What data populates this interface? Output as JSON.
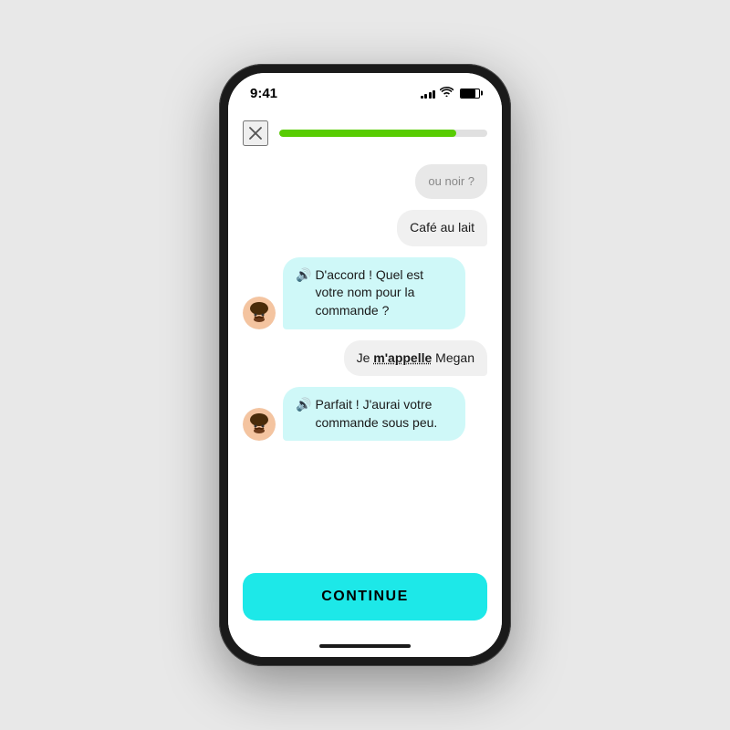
{
  "statusBar": {
    "time": "9:41",
    "signalBars": [
      3,
      5,
      7,
      9,
      11
    ],
    "batteryPercent": 80
  },
  "topBar": {
    "progressPercent": 85,
    "closeLabel": "×"
  },
  "chat": {
    "messages": [
      {
        "id": "msg1",
        "side": "right-partial",
        "text": "ou noir ?"
      },
      {
        "id": "msg2",
        "side": "right",
        "text": "Café au lait"
      },
      {
        "id": "msg3",
        "side": "left",
        "speakerIcon": "🔊",
        "text": "D'accord ! Quel est votre nom pour la commande ?"
      },
      {
        "id": "msg4",
        "side": "right",
        "textParts": [
          {
            "text": "Je ",
            "bold": false,
            "underline": false
          },
          {
            "text": "m'appelle",
            "bold": true,
            "underline": true
          },
          {
            "text": " Megan",
            "bold": false,
            "underline": false
          }
        ]
      },
      {
        "id": "msg5",
        "side": "left",
        "speakerIcon": "🔊",
        "text": "Parfait ! J'aurai votre commande sous peu."
      }
    ],
    "avatarEmoji": "🧔"
  },
  "continueButton": {
    "label": "CONTINUE"
  }
}
